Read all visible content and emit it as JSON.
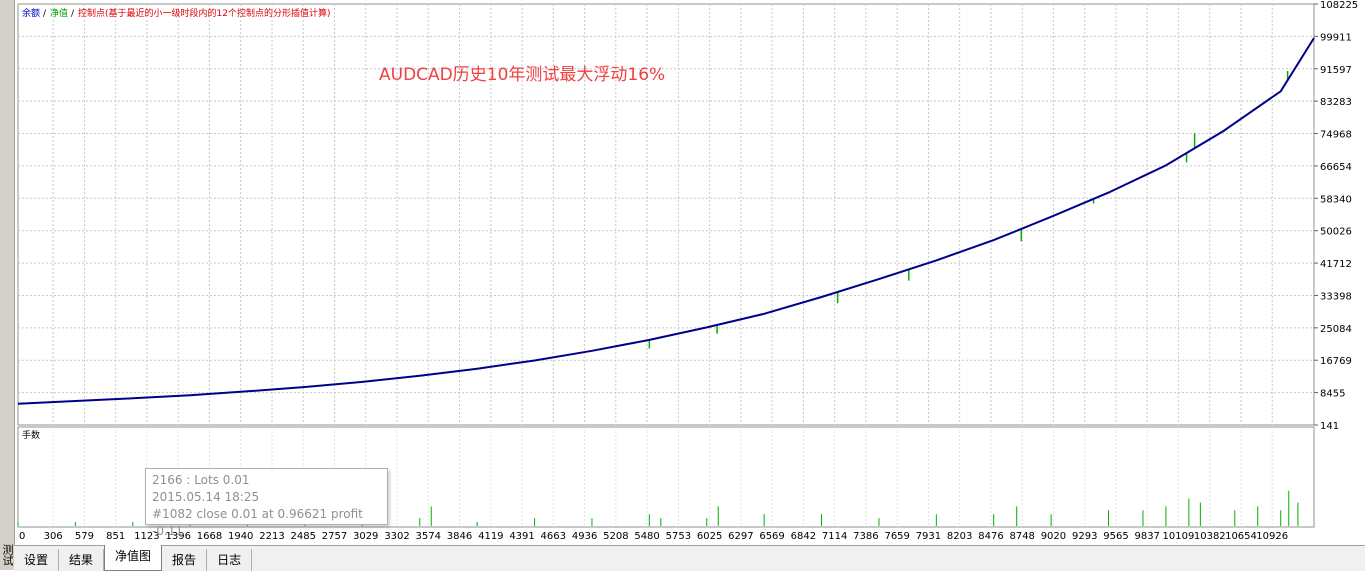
{
  "window": {
    "side_tab_label": "测试"
  },
  "tabs": [
    {
      "label": "设置",
      "active": false
    },
    {
      "label": "结果",
      "active": false
    },
    {
      "label": "净值图",
      "active": true
    },
    {
      "label": "报告",
      "active": false
    },
    {
      "label": "日志",
      "active": false
    }
  ],
  "legend": {
    "items": [
      {
        "label": "余额",
        "color": "#0000c0"
      },
      {
        "label": "净值",
        "color": "#00a000"
      },
      {
        "label": "控制点(基于最近的小一级时段内的12个控制点的分形插值计算)",
        "color": "#e00000"
      }
    ],
    "separator": "/"
  },
  "annotation": {
    "text": "AUDCAD历史10年测试最大浮动16%",
    "color": "#f04040"
  },
  "lower_panel": {
    "label": "手数"
  },
  "tooltip": {
    "line1": "2166 : Lots 0.01",
    "line2": "2015.05.14 18:25",
    "line3": "#1082 close 0.01 at 0.96621 profit -0.11"
  },
  "chart_data": {
    "type": "line",
    "x_ticks": [
      "0",
      "306",
      "579",
      "851",
      "1123",
      "1396",
      "1668",
      "1940",
      "2213",
      "2485",
      "2757",
      "3029",
      "3302",
      "3574",
      "3846",
      "4119",
      "4391",
      "4663",
      "4936",
      "5208",
      "5480",
      "5753",
      "6025",
      "6297",
      "6569",
      "6842",
      "7114",
      "7386",
      "7659",
      "7931",
      "8203",
      "8476",
      "8748",
      "9020",
      "9293",
      "9565",
      "9837",
      "10109",
      "10382",
      "10654",
      "10926"
    ],
    "y_ticks": [
      "108225",
      "99911",
      "91597",
      "83283",
      "74968",
      "66654",
      "58340",
      "50026",
      "41712",
      "33398",
      "25084",
      "16769",
      "8455",
      "141"
    ],
    "ylim": [
      141,
      108225
    ],
    "xlim": [
      0,
      11290
    ],
    "grid": true,
    "series": [
      {
        "name": "余额",
        "color": "#0000a0",
        "x": [
          0,
          500,
          1000,
          1500,
          2000,
          2500,
          3000,
          3500,
          4000,
          4500,
          5000,
          5500,
          6000,
          6500,
          7000,
          7500,
          8000,
          8500,
          9000,
          9500,
          10000,
          10500,
          11000,
          11290
        ],
        "y": [
          5600,
          6300,
          7000,
          7800,
          8800,
          9900,
          11200,
          12800,
          14600,
          16700,
          19200,
          22000,
          25200,
          28700,
          33000,
          37600,
          42400,
          47600,
          53600,
          59800,
          66800,
          75600,
          85800,
          99500
        ]
      }
    ],
    "equity_drawdowns": [
      {
        "x": 5500,
        "y": 19800
      },
      {
        "x": 6090,
        "y": 23600
      },
      {
        "x": 7140,
        "y": 31400
      },
      {
        "x": 7760,
        "y": 37200
      },
      {
        "x": 8740,
        "y": 47300
      },
      {
        "x": 9370,
        "y": 57000
      },
      {
        "x": 10180,
        "y": 67600
      },
      {
        "x": 10250,
        "y": 75000
      },
      {
        "x": 11060,
        "y": 91000
      }
    ],
    "lots": {
      "label": "手数",
      "x": [
        0,
        500,
        1000,
        1500,
        2000,
        2500,
        3000,
        3500,
        3600,
        4000,
        4500,
        5000,
        5500,
        5600,
        6000,
        6100,
        6500,
        7000,
        7500,
        8000,
        8500,
        8700,
        9000,
        9500,
        9800,
        10000,
        10200,
        10300,
        10600,
        10800,
        11000,
        11070,
        11150
      ],
      "y": [
        0.01,
        0.01,
        0.01,
        0.01,
        0.02,
        0.01,
        0.01,
        0.02,
        0.05,
        0.01,
        0.02,
        0.02,
        0.03,
        0.02,
        0.02,
        0.05,
        0.03,
        0.03,
        0.02,
        0.03,
        0.03,
        0.05,
        0.03,
        0.04,
        0.04,
        0.05,
        0.07,
        0.06,
        0.04,
        0.05,
        0.04,
        0.09,
        0.06
      ]
    }
  }
}
